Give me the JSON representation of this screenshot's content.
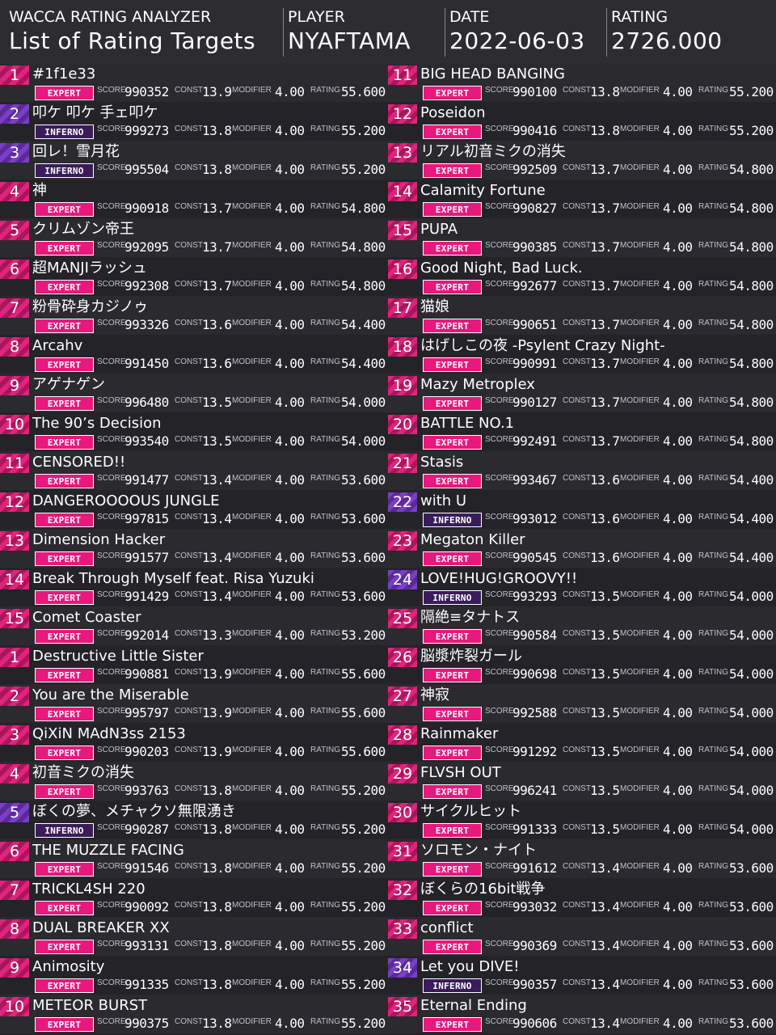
{
  "header": {
    "app_title": "WACCA RATING ANALYZER",
    "page_title": "List of Rating Targets",
    "player_label": "PLAYER",
    "player_value": "NYAFTAMA",
    "date_label": "DATE",
    "date_value": "2022-06-03",
    "rating_label": "RATING",
    "rating_value": "2726.000"
  },
  "field_labels": {
    "score": "SCORE",
    "const": "CONST",
    "modifier": "MODIFIER",
    "rating": "RATING"
  },
  "colors": {
    "expert": "#e8187c",
    "inferno": "#3a1c5a",
    "background": "#232328"
  },
  "left_entries": [
    {
      "rank": "1",
      "title": "#1f1e33",
      "difficulty": "EXPERT",
      "score": "990352",
      "const": "13.9",
      "modifier": "4.00",
      "rating": "55.600"
    },
    {
      "rank": "2",
      "title": "叩ケ 叩ケ 手ェ叩ケ",
      "difficulty": "INFERNO",
      "score": "999273",
      "const": "13.8",
      "modifier": "4.00",
      "rating": "55.200"
    },
    {
      "rank": "3",
      "title": "回レ！雪月花",
      "difficulty": "INFERNO",
      "score": "995504",
      "const": "13.8",
      "modifier": "4.00",
      "rating": "55.200"
    },
    {
      "rank": "4",
      "title": "神",
      "difficulty": "EXPERT",
      "score": "990918",
      "const": "13.7",
      "modifier": "4.00",
      "rating": "54.800"
    },
    {
      "rank": "5",
      "title": "クリムゾン帝王",
      "difficulty": "EXPERT",
      "score": "992095",
      "const": "13.7",
      "modifier": "4.00",
      "rating": "54.800"
    },
    {
      "rank": "6",
      "title": "超MANJIラッシュ",
      "difficulty": "EXPERT",
      "score": "992308",
      "const": "13.7",
      "modifier": "4.00",
      "rating": "54.800"
    },
    {
      "rank": "7",
      "title": "粉骨砕身カジノゥ",
      "difficulty": "EXPERT",
      "score": "993326",
      "const": "13.6",
      "modifier": "4.00",
      "rating": "54.400"
    },
    {
      "rank": "8",
      "title": "Arcahv",
      "difficulty": "EXPERT",
      "score": "991450",
      "const": "13.6",
      "modifier": "4.00",
      "rating": "54.400"
    },
    {
      "rank": "9",
      "title": "アゲナゲン",
      "difficulty": "EXPERT",
      "score": "996480",
      "const": "13.5",
      "modifier": "4.00",
      "rating": "54.000"
    },
    {
      "rank": "10",
      "title": "The 90’s Decision",
      "difficulty": "EXPERT",
      "score": "993540",
      "const": "13.5",
      "modifier": "4.00",
      "rating": "54.000"
    },
    {
      "rank": "11",
      "title": "CENSORED!!",
      "difficulty": "EXPERT",
      "score": "991477",
      "const": "13.4",
      "modifier": "4.00",
      "rating": "53.600"
    },
    {
      "rank": "12",
      "title": "DANGEROOOOUS JUNGLE",
      "difficulty": "EXPERT",
      "score": "997815",
      "const": "13.4",
      "modifier": "4.00",
      "rating": "53.600"
    },
    {
      "rank": "13",
      "title": "Dimension Hacker",
      "difficulty": "EXPERT",
      "score": "991577",
      "const": "13.4",
      "modifier": "4.00",
      "rating": "53.600"
    },
    {
      "rank": "14",
      "title": "Break Through Myself feat. Risa Yuzuki",
      "difficulty": "EXPERT",
      "score": "991429",
      "const": "13.4",
      "modifier": "4.00",
      "rating": "53.600"
    },
    {
      "rank": "15",
      "title": "Comet Coaster",
      "difficulty": "EXPERT",
      "score": "992014",
      "const": "13.3",
      "modifier": "4.00",
      "rating": "53.200"
    },
    {
      "rank": "1",
      "title": "Destructive Little Sister",
      "difficulty": "EXPERT",
      "score": "990881",
      "const": "13.9",
      "modifier": "4.00",
      "rating": "55.600"
    },
    {
      "rank": "2",
      "title": "You are the Miserable",
      "difficulty": "EXPERT",
      "score": "995797",
      "const": "13.9",
      "modifier": "4.00",
      "rating": "55.600"
    },
    {
      "rank": "3",
      "title": "QiXiN MAdN3ss 2153",
      "difficulty": "EXPERT",
      "score": "990203",
      "const": "13.9",
      "modifier": "4.00",
      "rating": "55.600"
    },
    {
      "rank": "4",
      "title": "初音ミクの消失",
      "difficulty": "EXPERT",
      "score": "993763",
      "const": "13.8",
      "modifier": "4.00",
      "rating": "55.200"
    },
    {
      "rank": "5",
      "title": "ぼくの夢、メチャクソ無限湧き",
      "difficulty": "INFERNO",
      "score": "990287",
      "const": "13.8",
      "modifier": "4.00",
      "rating": "55.200"
    },
    {
      "rank": "6",
      "title": "THE MUZZLE FACING",
      "difficulty": "EXPERT",
      "score": "991546",
      "const": "13.8",
      "modifier": "4.00",
      "rating": "55.200"
    },
    {
      "rank": "7",
      "title": "TRICKL4SH 220",
      "difficulty": "EXPERT",
      "score": "990092",
      "const": "13.8",
      "modifier": "4.00",
      "rating": "55.200"
    },
    {
      "rank": "8",
      "title": "DUAL BREAKER XX",
      "difficulty": "EXPERT",
      "score": "993131",
      "const": "13.8",
      "modifier": "4.00",
      "rating": "55.200"
    },
    {
      "rank": "9",
      "title": "Animosity",
      "difficulty": "EXPERT",
      "score": "991335",
      "const": "13.8",
      "modifier": "4.00",
      "rating": "55.200"
    },
    {
      "rank": "10",
      "title": "METEOR BURST",
      "difficulty": "EXPERT",
      "score": "990375",
      "const": "13.8",
      "modifier": "4.00",
      "rating": "55.200"
    }
  ],
  "right_entries": [
    {
      "rank": "11",
      "title": "BIG HEAD BANGING",
      "difficulty": "EXPERT",
      "score": "990100",
      "const": "13.8",
      "modifier": "4.00",
      "rating": "55.200"
    },
    {
      "rank": "12",
      "title": "Poseidon",
      "difficulty": "EXPERT",
      "score": "990416",
      "const": "13.8",
      "modifier": "4.00",
      "rating": "55.200"
    },
    {
      "rank": "13",
      "title": "リアル初音ミクの消失",
      "difficulty": "EXPERT",
      "score": "992509",
      "const": "13.7",
      "modifier": "4.00",
      "rating": "54.800"
    },
    {
      "rank": "14",
      "title": "Calamity Fortune",
      "difficulty": "EXPERT",
      "score": "990827",
      "const": "13.7",
      "modifier": "4.00",
      "rating": "54.800"
    },
    {
      "rank": "15",
      "title": "PUPA",
      "difficulty": "EXPERT",
      "score": "990385",
      "const": "13.7",
      "modifier": "4.00",
      "rating": "54.800"
    },
    {
      "rank": "16",
      "title": "Good Night, Bad Luck.",
      "difficulty": "EXPERT",
      "score": "992677",
      "const": "13.7",
      "modifier": "4.00",
      "rating": "54.800"
    },
    {
      "rank": "17",
      "title": "猫娘",
      "difficulty": "EXPERT",
      "score": "990651",
      "const": "13.7",
      "modifier": "4.00",
      "rating": "54.800"
    },
    {
      "rank": "18",
      "title": "はげしこの夜 -Psylent Crazy Night-",
      "difficulty": "EXPERT",
      "score": "990991",
      "const": "13.7",
      "modifier": "4.00",
      "rating": "54.800"
    },
    {
      "rank": "19",
      "title": "Mazy Metroplex",
      "difficulty": "EXPERT",
      "score": "990127",
      "const": "13.7",
      "modifier": "4.00",
      "rating": "54.800"
    },
    {
      "rank": "20",
      "title": "BATTLE NO.1",
      "difficulty": "EXPERT",
      "score": "992491",
      "const": "13.7",
      "modifier": "4.00",
      "rating": "54.800"
    },
    {
      "rank": "21",
      "title": "Stasis",
      "difficulty": "EXPERT",
      "score": "993467",
      "const": "13.6",
      "modifier": "4.00",
      "rating": "54.400"
    },
    {
      "rank": "22",
      "title": "with U",
      "difficulty": "INFERNO",
      "score": "993012",
      "const": "13.6",
      "modifier": "4.00",
      "rating": "54.400"
    },
    {
      "rank": "23",
      "title": "Megaton Killer",
      "difficulty": "EXPERT",
      "score": "990545",
      "const": "13.6",
      "modifier": "4.00",
      "rating": "54.400"
    },
    {
      "rank": "24",
      "title": "LOVE!HUG!GROOVY!!",
      "difficulty": "INFERNO",
      "score": "993293",
      "const": "13.5",
      "modifier": "4.00",
      "rating": "54.000"
    },
    {
      "rank": "25",
      "title": "隔絶≡タナトス",
      "difficulty": "EXPERT",
      "score": "990584",
      "const": "13.5",
      "modifier": "4.00",
      "rating": "54.000"
    },
    {
      "rank": "26",
      "title": "脳漿炸裂ガール",
      "difficulty": "EXPERT",
      "score": "990698",
      "const": "13.5",
      "modifier": "4.00",
      "rating": "54.000"
    },
    {
      "rank": "27",
      "title": "神寂",
      "difficulty": "EXPERT",
      "score": "992588",
      "const": "13.5",
      "modifier": "4.00",
      "rating": "54.000"
    },
    {
      "rank": "28",
      "title": "Rainmaker",
      "difficulty": "EXPERT",
      "score": "991292",
      "const": "13.5",
      "modifier": "4.00",
      "rating": "54.000"
    },
    {
      "rank": "29",
      "title": "FLVSH OUT",
      "difficulty": "EXPERT",
      "score": "996241",
      "const": "13.5",
      "modifier": "4.00",
      "rating": "54.000"
    },
    {
      "rank": "30",
      "title": "サイクルヒット",
      "difficulty": "EXPERT",
      "score": "991333",
      "const": "13.5",
      "modifier": "4.00",
      "rating": "54.000"
    },
    {
      "rank": "31",
      "title": "ソロモン・ナイト",
      "difficulty": "EXPERT",
      "score": "991612",
      "const": "13.4",
      "modifier": "4.00",
      "rating": "53.600"
    },
    {
      "rank": "32",
      "title": "ぼくらの16bit戦争",
      "difficulty": "EXPERT",
      "score": "993032",
      "const": "13.4",
      "modifier": "4.00",
      "rating": "53.600"
    },
    {
      "rank": "33",
      "title": "conflict",
      "difficulty": "EXPERT",
      "score": "990369",
      "const": "13.4",
      "modifier": "4.00",
      "rating": "53.600"
    },
    {
      "rank": "34",
      "title": "Let you DIVE!",
      "difficulty": "INFERNO",
      "score": "990357",
      "const": "13.4",
      "modifier": "4.00",
      "rating": "53.600"
    },
    {
      "rank": "35",
      "title": "Eternal Ending",
      "difficulty": "EXPERT",
      "score": "990606",
      "const": "13.4",
      "modifier": "4.00",
      "rating": "53.600"
    }
  ]
}
